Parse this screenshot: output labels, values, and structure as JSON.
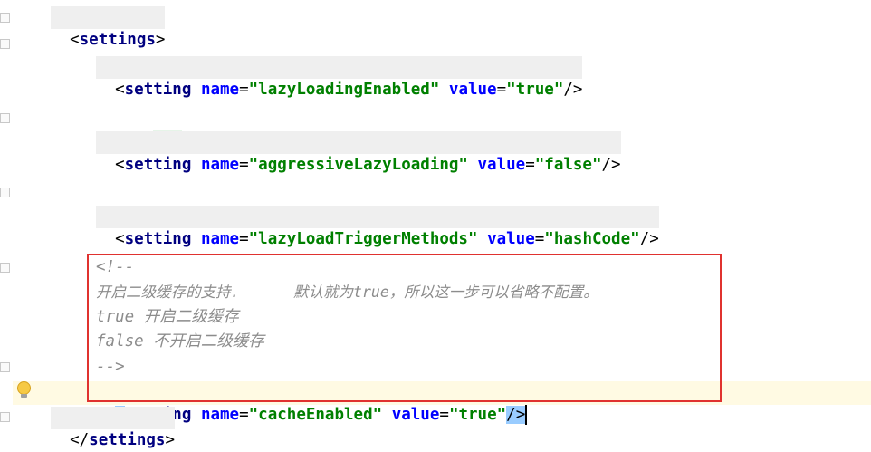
{
  "editor": {
    "fold_collapsed_text": "...",
    "lines": {
      "settings_open": "settings",
      "comment_open": "<!--",
      "comment_close": "-->",
      "setting_tag": "setting",
      "attr_name": "name",
      "attr_value": "value",
      "s1_name": "\"lazyLoadingEnabled\"",
      "s1_value": "\"true\"",
      "s2_name": "\"aggressiveLazyLoading\"",
      "s2_value": "\"false\"",
      "s3_name": "\"lazyLoadTriggerMethods\"",
      "s3_value": "\"hashCode\"",
      "c_line1": "开启二级缓存的支持.      默认就为true，所以这一步可以省略不配置。",
      "c_line2": "true 开启二级缓存",
      "c_line3": "false 不开启二级缓存",
      "s4_name": "\"cacheEnabled\"",
      "s4_value": "\"true\"",
      "settings_close": "settings"
    }
  },
  "colors": {
    "tag": "#000080",
    "attribute": "#0000ff",
    "string": "#008000",
    "comment": "#8c8c8c",
    "highlight_box": "#e0322f"
  },
  "icons": [
    "fold-icon",
    "intention-bulb-icon"
  ]
}
